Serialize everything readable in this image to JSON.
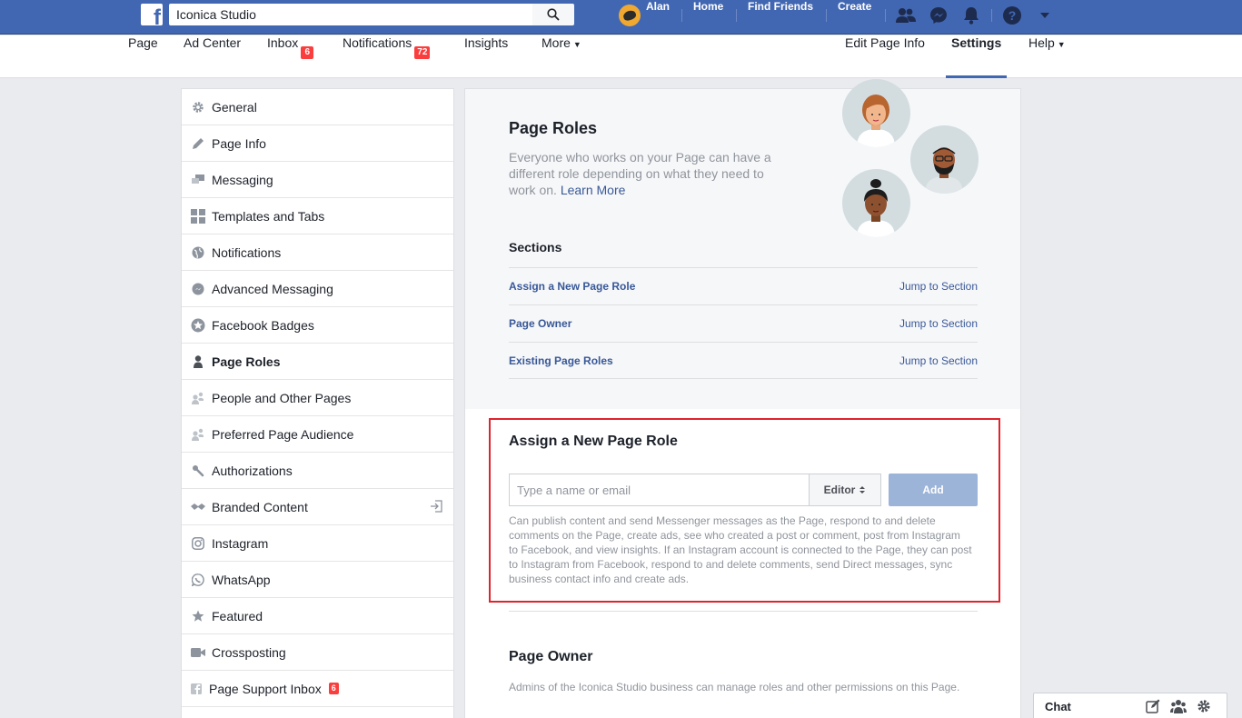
{
  "topbar": {
    "search_value": "Iconica Studio",
    "user_name": "Alan",
    "links": {
      "home": "Home",
      "find_friends": "Find Friends",
      "create": "Create"
    }
  },
  "pagenav": {
    "page": "Page",
    "ad_center": "Ad Center",
    "inbox": "Inbox",
    "inbox_badge": "6",
    "notifications": "Notifications",
    "notifications_badge": "72",
    "insights": "Insights",
    "more": "More",
    "edit_page_info": "Edit Page Info",
    "settings": "Settings",
    "help": "Help"
  },
  "sidebar": {
    "items": [
      {
        "label": "General",
        "icon": "gear-icon"
      },
      {
        "label": "Page Info",
        "icon": "pencil-icon"
      },
      {
        "label": "Messaging",
        "icon": "chat-bubbles-icon"
      },
      {
        "label": "Templates and Tabs",
        "icon": "grid-icon"
      },
      {
        "label": "Notifications",
        "icon": "globe-icon"
      },
      {
        "label": "Advanced Messaging",
        "icon": "messenger-icon"
      },
      {
        "label": "Facebook Badges",
        "icon": "badge-icon"
      },
      {
        "label": "Page Roles",
        "icon": "person-icon",
        "active": true
      },
      {
        "label": "People and Other Pages",
        "icon": "people-icon"
      },
      {
        "label": "Preferred Page Audience",
        "icon": "people-icon"
      },
      {
        "label": "Authorizations",
        "icon": "wrench-icon"
      },
      {
        "label": "Branded Content",
        "icon": "handshake-icon"
      },
      {
        "label": "Instagram",
        "icon": "instagram-icon"
      },
      {
        "label": "WhatsApp",
        "icon": "whatsapp-icon"
      },
      {
        "label": "Featured",
        "icon": "star-icon"
      },
      {
        "label": "Crossposting",
        "icon": "video-camera-icon"
      },
      {
        "label": "Page Support Inbox",
        "icon": "facebook-icon",
        "badge": "6"
      }
    ]
  },
  "main": {
    "title": "Page Roles",
    "description": "Everyone who works on your Page can have a different role depending on what they need to work on.",
    "learn_more": "Learn More",
    "sections_label": "Sections",
    "sections": [
      {
        "name": "Assign a New Page Role",
        "jump": "Jump to Section"
      },
      {
        "name": "Page Owner",
        "jump": "Jump to Section"
      },
      {
        "name": "Existing Page Roles",
        "jump": "Jump to Section"
      }
    ],
    "assign": {
      "title": "Assign a New Page Role",
      "input_placeholder": "Type a name or email",
      "role_value": "Editor",
      "add_label": "Add",
      "description": "Can publish content and send Messenger messages as the Page, respond to and delete comments on the Page, create ads, see who created a post or comment, post from Instagram to Facebook, and view insights. If an Instagram account is connected to the Page, they can post to Instagram from Facebook, respond to and delete comments, send Direct messages, sync business contact info and create ads."
    },
    "owner": {
      "title": "Page Owner",
      "description": "Admins of the Iconica Studio business can manage roles and other permissions on this Page."
    }
  },
  "chat": {
    "label": "Chat"
  },
  "colors": {
    "brand": "#4267b2",
    "link": "#385898",
    "badge": "#fa3e3e",
    "highlight": "#e0242e"
  }
}
